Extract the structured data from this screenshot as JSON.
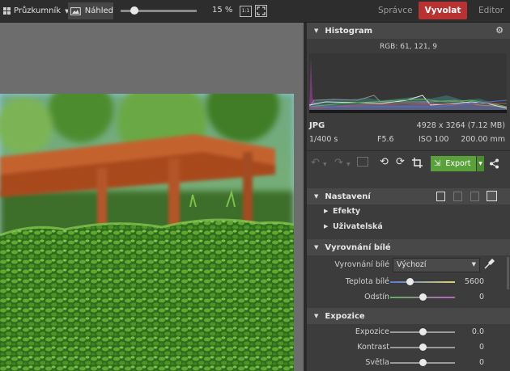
{
  "toolbar": {
    "browser_label": "Průzkumník",
    "preview_label": "Náhled",
    "zoom_value": "15 %",
    "fit_icon": "fullscreen-icon",
    "ratio_label": "1:1",
    "modes": [
      "Správce",
      "Vyvolat",
      "Editor"
    ],
    "active_mode": "Vyvolat",
    "accent_color": "#b83232"
  },
  "histogram": {
    "title": "Histogram",
    "rgb_readout": "RGB: 61, 121, 9"
  },
  "file_info": {
    "format": "JPG",
    "dimensions": "4928 x 3264 (7.12 MB)",
    "shutter": "1/400 s",
    "aperture": "F5.6",
    "iso": "ISO 100",
    "focal": "200.00 mm"
  },
  "tools": {
    "export_label": "Export",
    "export_color": "#5aa13c"
  },
  "sections": {
    "nastaveni": "Nastavení",
    "efekty": "Efekty",
    "uzivatelska": "Uživatelská",
    "vyrovnani": "Vyrovnání bílé",
    "expozice": "Expozice"
  },
  "white_balance": {
    "label": "Vyrovnání bílé",
    "value": "Výchozí",
    "teplota_label": "Teplota bílé",
    "teplota_value": "5600",
    "odstin_label": "Odstín",
    "odstin_value": "0"
  },
  "exposure": {
    "expozice_label": "Expozice",
    "expozice_value": "0.0",
    "kontrast_label": "Kontrast",
    "kontrast_value": "0",
    "svetla_label": "Světla",
    "svetla_value": "0"
  },
  "sliders": {
    "zoom_fraction": 0.18,
    "teplota_fraction": 0.3,
    "odstin_fraction": 0.5,
    "expozice_fraction": 0.5,
    "kontrast_fraction": 0.5,
    "svetla_fraction": 0.5
  }
}
